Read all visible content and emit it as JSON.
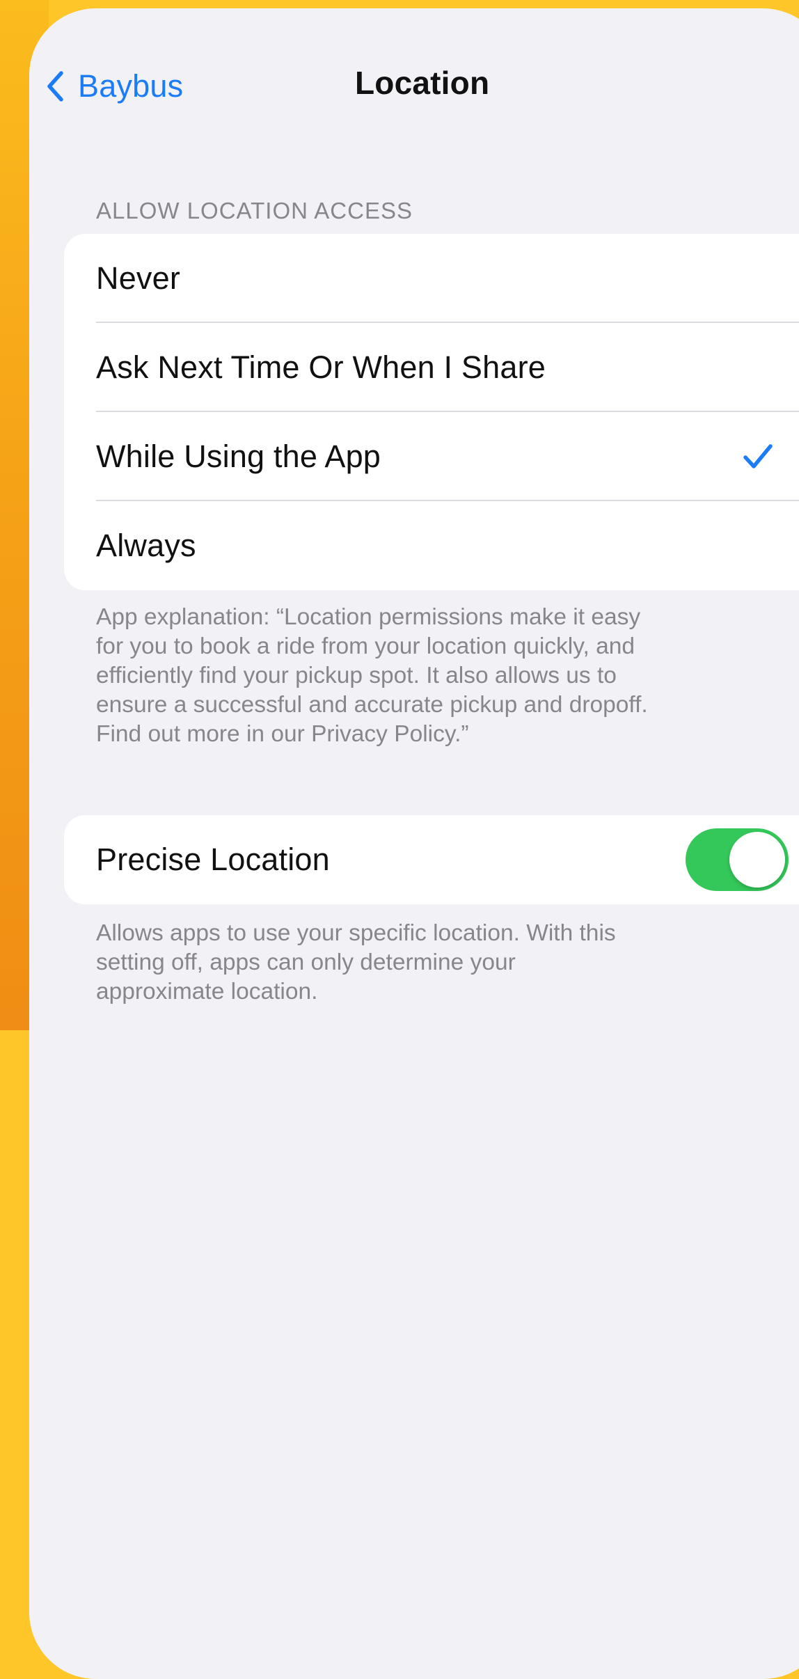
{
  "colors": {
    "background": "#FEC629",
    "accent": "#1B7CF5",
    "toggle_on": "#34C759",
    "screen": "#F1F1F6"
  },
  "nav": {
    "back_icon": "chevron-left-icon",
    "back_label": "Baybus",
    "title": "Location"
  },
  "access": {
    "header": "ALLOW LOCATION ACCESS",
    "options": [
      {
        "label": "Never",
        "selected": false
      },
      {
        "label": "Ask Next Time Or When I Share",
        "selected": false
      },
      {
        "label": "While Using the App",
        "selected": true
      },
      {
        "label": "Always",
        "selected": false
      }
    ],
    "selected_icon": "checkmark-icon",
    "footnote_lines": [
      "App explanation: “Location permissions make it easy",
      "for you to book a ride from your location quickly, and",
      "efficiently find your pickup spot. It also allows us to",
      "ensure a successful and accurate pickup and dropoff.",
      "Find out more in our Privacy Policy.”"
    ]
  },
  "precise": {
    "label": "Precise Location",
    "enabled": true,
    "footnote_lines": [
      "Allows apps to use your specific location. With this",
      "setting off, apps can only determine your",
      "approximate location."
    ]
  }
}
